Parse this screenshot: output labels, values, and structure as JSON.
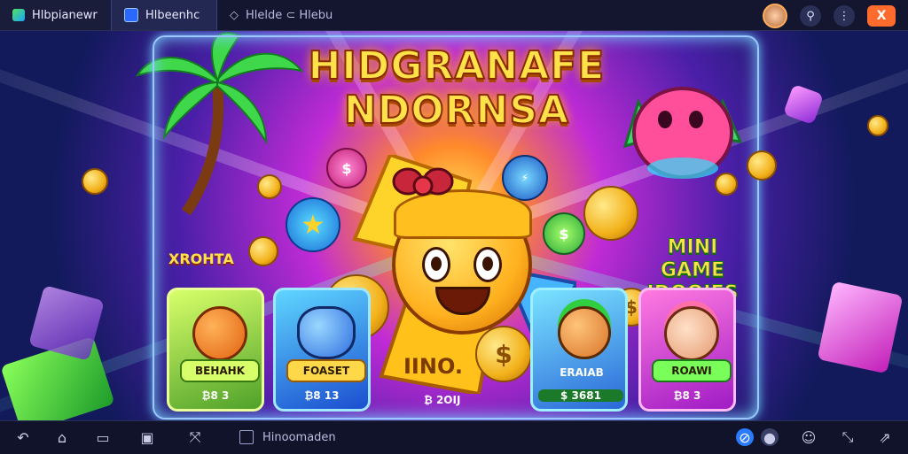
{
  "topbar": {
    "app_tab": {
      "label": "Hlbpianewr",
      "icon": "app-logo-icon"
    },
    "active_tab": {
      "label": "Hlbeenhc",
      "icon": "tab-game-icon"
    },
    "other_tab": {
      "label": "Hlelde ⊂ Hlebu",
      "icon": "diamond-icon"
    },
    "buttons": [
      "avatar",
      "search-icon",
      "more-icon",
      "close-icon"
    ],
    "close_label": "X"
  },
  "game": {
    "title_line1": "HIDGRANAFE",
    "title_line2": "NDORNSA",
    "left_label": "XROHTA",
    "mini_title_line1": "MINI GAME",
    "mini_title_line2": "IDOOIES",
    "center_badge": "IINO.",
    "center_value": "₿ 2OIJ",
    "coin_text": "$"
  },
  "cards": [
    {
      "title": "BEHAHK",
      "value": "₿8 3",
      "color": "#a5e634",
      "border": "#e8ff7a"
    },
    {
      "title": "FOASET",
      "value": "₿8 13",
      "color": "#3fa7ff",
      "border": "#8fe0ff"
    },
    {
      "title": "ERAIAB",
      "value": "$ 3681",
      "color": "#32c7e0",
      "border": "#8ff0ff"
    },
    {
      "title": "ROAWI",
      "value": "₿8 3",
      "color": "#d84ae0",
      "border": "#ff9cf5"
    }
  ],
  "bottombar": {
    "nav": [
      "back-icon",
      "home-icon",
      "folder-icon",
      "image-icon",
      "crop-icon"
    ],
    "url_text": "Hinoomaden",
    "right_icons": [
      "globe-icon",
      "settings-icon",
      "fullscreen-icon",
      "share-icon"
    ]
  },
  "colors": {
    "topbar": "#13162e",
    "accent": "#ff6b2c",
    "gold": "#ffe24a"
  }
}
